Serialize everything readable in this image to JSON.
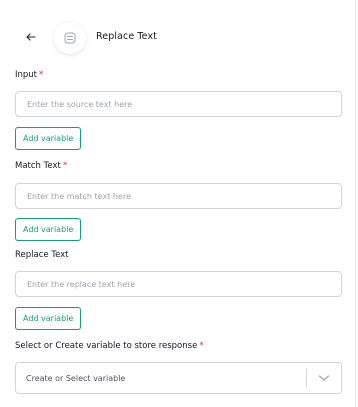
{
  "header": {
    "back_icon": "back-arrow-icon",
    "node_icon": "replace-text-node-icon",
    "title": "Replace Text"
  },
  "fields": {
    "input": {
      "label": "Input",
      "required_mark": "*",
      "placeholder": "Enter the source text here",
      "value": "",
      "add_variable_label": "Add variable"
    },
    "match_text": {
      "label": "Match Text",
      "required_mark": "*",
      "placeholder": "Enter the match text here",
      "value": "",
      "add_variable_label": "Add variable"
    },
    "replace_text": {
      "label": "Replace Text",
      "placeholder": "Enter the replace text here",
      "value": "",
      "add_variable_label": "Add variable"
    },
    "response_variable": {
      "label": "Select or Create variable to store response",
      "required_mark": "*",
      "placeholder": "Create or Select variable",
      "icon": "chevron-down-icon"
    }
  },
  "colors": {
    "accent": "#1a9b7f",
    "required": "#e11d48",
    "border": "#d1d5db",
    "placeholder": "#9ca3af"
  }
}
